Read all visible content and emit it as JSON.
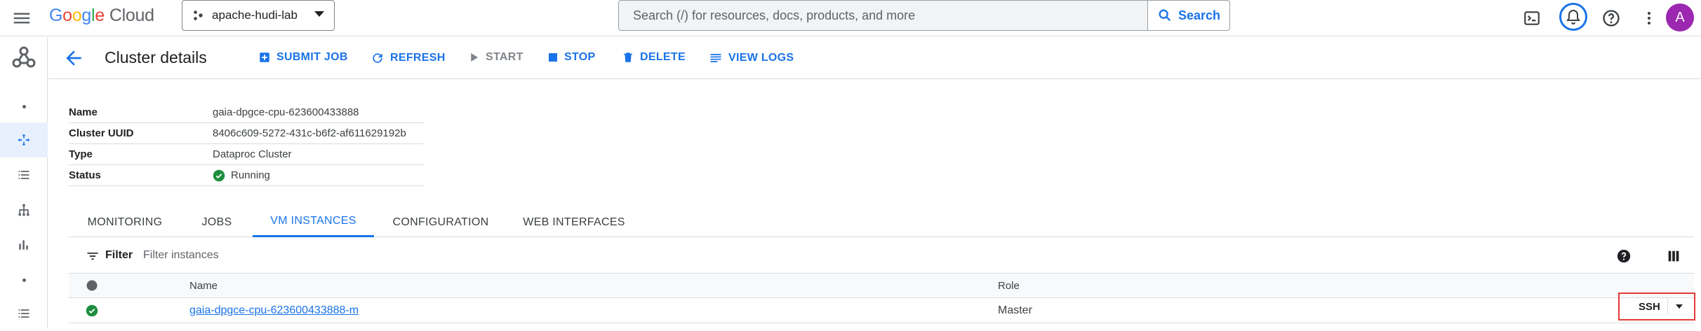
{
  "topbar": {
    "logo_letters": [
      "G",
      "o",
      "o",
      "g",
      "l",
      "e"
    ],
    "logo_product": "Cloud",
    "project_name": "apache-hudi-lab",
    "search_placeholder": "Search (/) for resources, docs, products, and more",
    "search_button": "Search",
    "avatar_letter": "A"
  },
  "header": {
    "title": "Cluster details",
    "actions": [
      {
        "label": "SUBMIT JOB",
        "icon": "add-box-icon",
        "enabled": true
      },
      {
        "label": "REFRESH",
        "icon": "refresh-icon",
        "enabled": true
      },
      {
        "label": "START",
        "icon": "play-icon",
        "enabled": false
      },
      {
        "label": "STOP",
        "icon": "stop-icon",
        "enabled": true
      },
      {
        "label": "DELETE",
        "icon": "trash-icon",
        "enabled": true
      },
      {
        "label": "VIEW LOGS",
        "icon": "logs-icon",
        "enabled": true
      }
    ]
  },
  "details": [
    {
      "key": "Name",
      "value": "gaia-dpgce-cpu-623600433888"
    },
    {
      "key": "Cluster UUID",
      "value": "8406c609-5272-431c-b6f2-af611629192b"
    },
    {
      "key": "Type",
      "value": "Dataproc Cluster"
    },
    {
      "key": "Status",
      "value": "Running",
      "status_icon": "check-circle-icon"
    }
  ],
  "tabs": [
    {
      "label": "MONITORING",
      "active": false
    },
    {
      "label": "JOBS",
      "active": false
    },
    {
      "label": "VM INSTANCES",
      "active": true
    },
    {
      "label": "CONFIGURATION",
      "active": false
    },
    {
      "label": "WEB INTERFACES",
      "active": false
    }
  ],
  "filter": {
    "label": "Filter",
    "placeholder": "Filter instances"
  },
  "table": {
    "columns": [
      "",
      "Name",
      "Role"
    ],
    "rows": [
      {
        "status_icon": "check-circle-icon",
        "name": "gaia-dpgce-cpu-623600433888-m",
        "role": "Master",
        "action": "SSH"
      }
    ]
  },
  "colors": {
    "accent": "#1a73e8",
    "status_ok": "#1e8e3e",
    "highlight": "#e53935",
    "avatar": "#9c27b0"
  }
}
